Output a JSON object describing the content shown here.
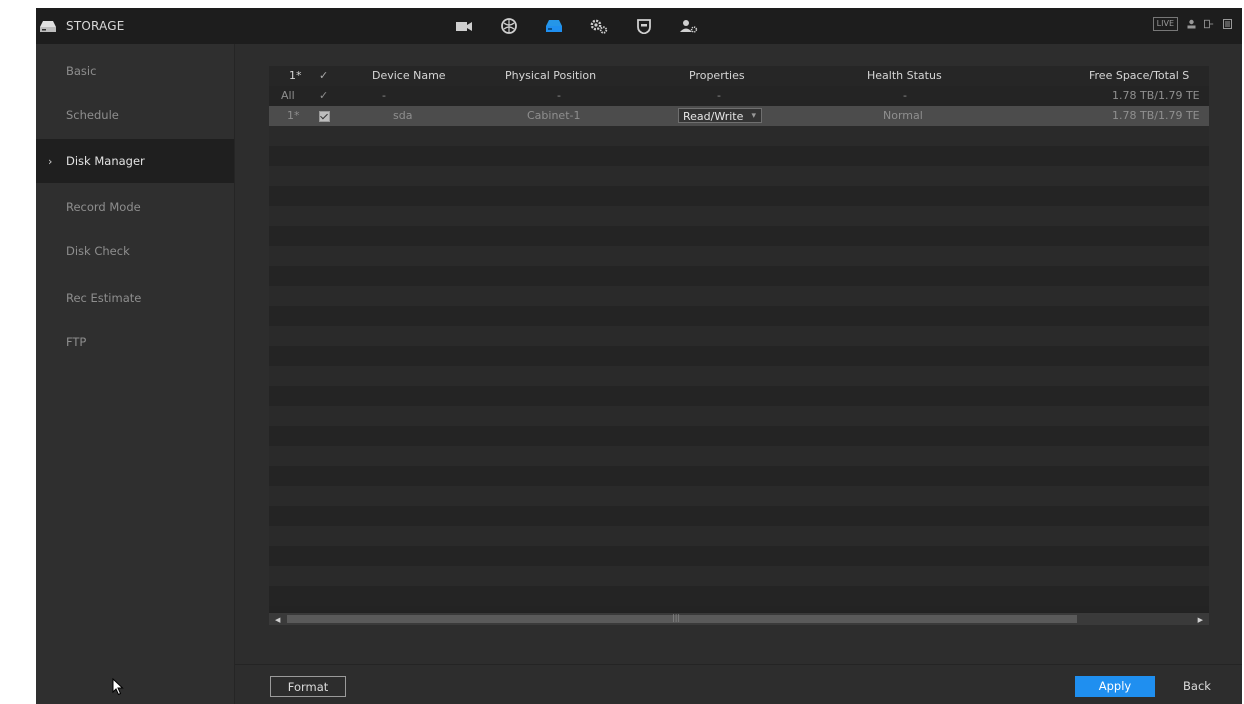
{
  "app": {
    "section_title": "STORAGE",
    "nav_icons": [
      "camera-icon",
      "network-icon",
      "storage-icon",
      "system-settings-icon",
      "security-shield-icon",
      "account-icon"
    ],
    "active_nav": "storage-icon",
    "live_label": "LIVE",
    "accent_color": "#1f8ff0"
  },
  "sidebar": {
    "items": [
      {
        "label": "Basic"
      },
      {
        "label": "Schedule"
      },
      {
        "label": "Disk Manager",
        "active": true
      },
      {
        "label": "Record Mode"
      },
      {
        "label": "Disk Check"
      },
      {
        "label": "Rec Estimate"
      },
      {
        "label": "FTP"
      }
    ]
  },
  "table": {
    "headers": {
      "index": "1*",
      "check": "✓",
      "device_name": "Device Name",
      "physical_position": "Physical Position",
      "properties": "Properties",
      "health_status": "Health Status",
      "free_total": "Free Space/Total S"
    },
    "all_row": {
      "index": "All",
      "check": "✓",
      "device_name": "-",
      "physical_position": "-",
      "properties": "-",
      "health_status": "-",
      "free_total": "1.78 TB/1.79 TE"
    },
    "rows": [
      {
        "index": "1*",
        "checked": true,
        "device_name": "sda",
        "physical_position": "Cabinet-1",
        "properties": "Read/Write",
        "health_status": "Normal",
        "free_total": "1.78 TB/1.79 TE"
      }
    ]
  },
  "buttons": {
    "format": "Format",
    "apply": "Apply",
    "back": "Back"
  }
}
